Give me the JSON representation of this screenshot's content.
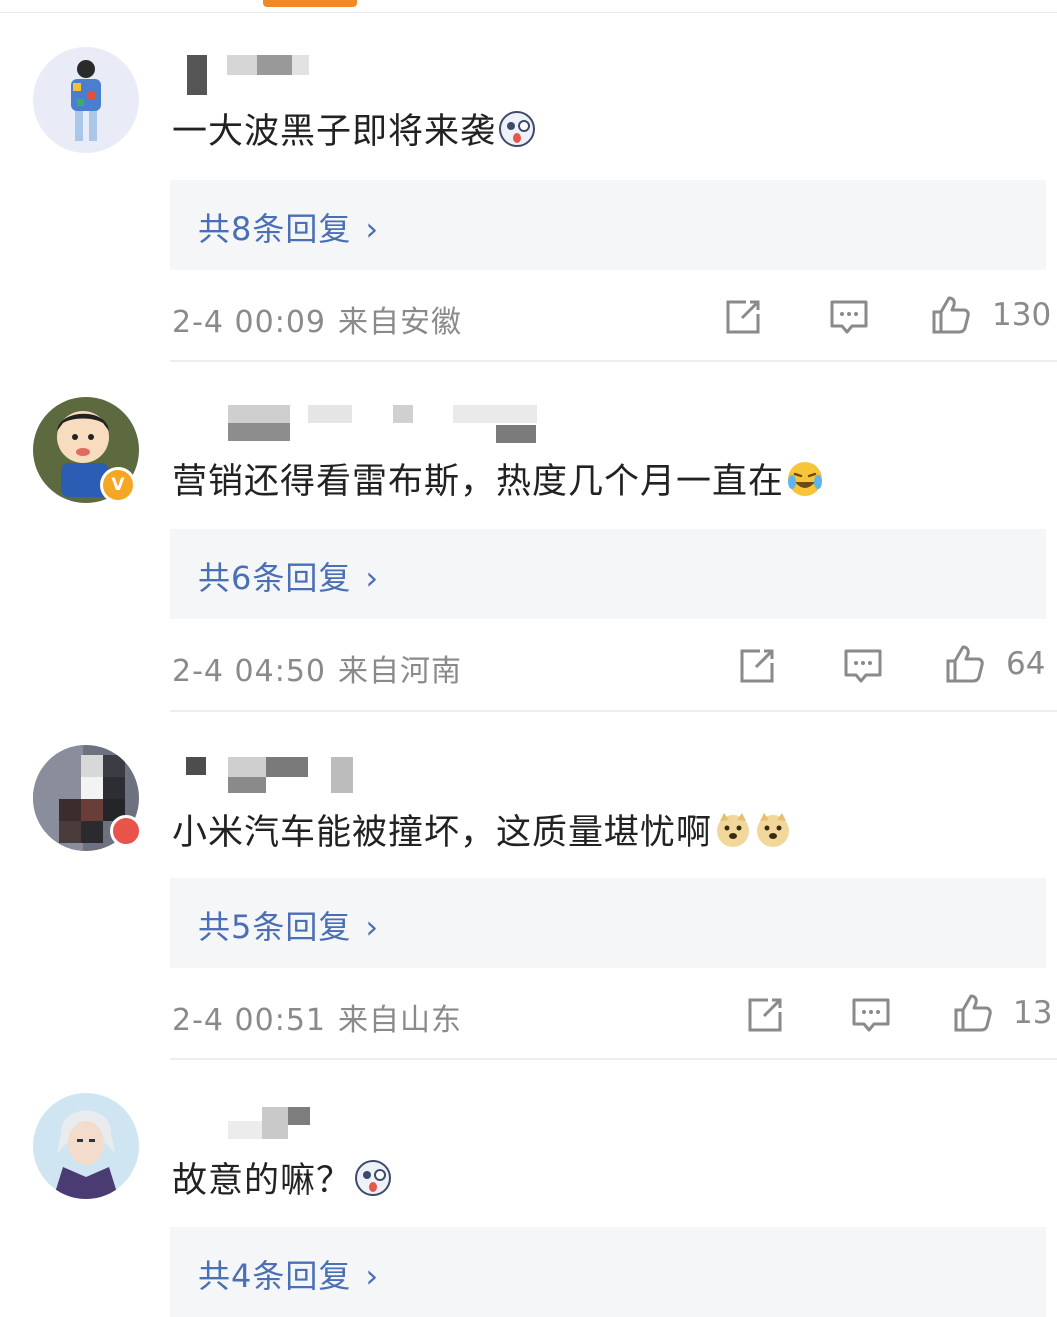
{
  "comments": [
    {
      "text": "一大波黑子即将来袭",
      "replies_label": "共8条回复",
      "reply_arrow": "›",
      "time": "2-4 00:09",
      "source": "来自安徽",
      "likes": "130",
      "emojis": [
        "shock-dog-emoji"
      ]
    },
    {
      "text": "营销还得看雷布斯，热度几个月一直在",
      "replies_label": "共6条回复",
      "reply_arrow": "›",
      "time": "2-4 04:50",
      "source": "来自河南",
      "likes": "64",
      "emojis": [
        "laugh-cry-emoji"
      ],
      "verified_badge": "V"
    },
    {
      "text": "小米汽车能被撞坏，这质量堪忧啊",
      "replies_label": "共5条回复",
      "reply_arrow": "›",
      "time": "2-4 00:51",
      "source": "来自山东",
      "likes": "13",
      "emojis": [
        "doge-emoji",
        "doge-emoji"
      ]
    },
    {
      "text": "故意的嘛？",
      "replies_label": "共4条回复",
      "reply_arrow": "›",
      "emojis": [
        "shock-dog-emoji"
      ]
    }
  ],
  "icons": {
    "share": "share-icon",
    "comment": "comment-icon",
    "like": "thumbs-up-icon"
  },
  "colors": {
    "accent": "#f08a24",
    "reply_link": "#4a6fb5",
    "meta_text": "#8a8a8a",
    "reply_bg": "#f5f6f8"
  }
}
